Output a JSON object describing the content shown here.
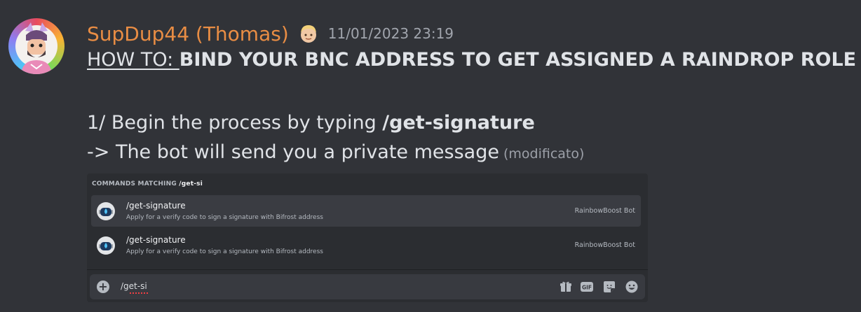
{
  "message": {
    "author": "SupDup44 (Thomas)",
    "author_color": "#e98d44",
    "author_emoji": "person-blond-hair-emoji",
    "timestamp": "11/01/2023 23:19",
    "line1_prefix": "HOW TO: ",
    "line1_bold": "BIND YOUR BNC ADDRESS TO GET ASSIGNED A RAINDROP ROLE",
    "line2_text": "1/ Begin the process by typing ",
    "line2_bold": "/get-signature",
    "line3_text": "-> The bot will send you a private message",
    "edited_label": "(modificato)"
  },
  "attachment": {
    "section_title": "COMMANDS MATCHING ",
    "section_query": "/get-si",
    "commands": [
      {
        "name": "/get-signature",
        "description": "Apply for a verify code to sign a signature with Bifrost address",
        "app": "RainbowBoost Bot",
        "icon": "rainbowboost-bot-avatar"
      },
      {
        "name": "/get-signature",
        "description": "Apply for a verify code to sign a signature with Bifrost address",
        "app": "RainbowBoost Bot",
        "icon": "rainbowboost-bot-avatar"
      }
    ],
    "input": {
      "value": "/get-si"
    },
    "toolbar_icons": [
      "gift-icon",
      "gif-icon",
      "sticker-icon",
      "emoji-icon"
    ]
  }
}
